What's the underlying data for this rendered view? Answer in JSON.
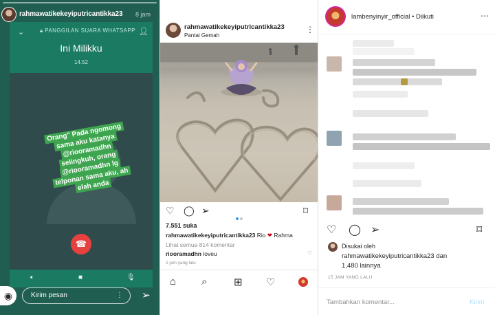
{
  "whatsapp_story": {
    "username": "rahmawatikekeyiputricantikka23",
    "time_ago": "8 jam",
    "call_type": "PANGGILAN SUARA WHATSAPP",
    "contact_name": "Ini Milikku",
    "call_duration": "14.52",
    "sticker_text": "Orang\" Pada ngomong sama aku katanya @riooramadhn selingkuh, orang @riooramadhn lg telponan sama aku, ah elah anda",
    "reply_placeholder": "Kirim pesan",
    "icons": {
      "back": "chevron-down-icon",
      "lock": "lock-icon",
      "add_participant": "add-person-icon",
      "end_call": "phone-hangup-icon",
      "speaker": "speaker-icon",
      "video": "video-icon",
      "mute": "mic-off-icon",
      "camera": "camera-icon",
      "menu": "more-vertical-icon",
      "send": "send-icon"
    }
  },
  "ig_post": {
    "username": "rahmawatikekeyiputricantikka23",
    "location": "Pantai Gemah",
    "likes": "7.551 suka",
    "caption_user": "rahmawatikekeyiputricantikka23",
    "caption_text_1": "Rio",
    "caption_text_2": "Rahma",
    "view_all_comments": "Lihat semua 814 komentar",
    "comment_user": "riooramadhn",
    "comment_text": "loveu",
    "time_ago": "2 jam yang lalu",
    "colors": {
      "carousel_active": "#3897f0",
      "carousel_inactive": "#c7c7c7",
      "heart": "#d0021b"
    }
  },
  "ig_comments": {
    "username": "lambenyinyir_official",
    "follow_status": "• Diikuti",
    "liked_by_prefix": "Disukai oleh",
    "liked_by_user": "rahmawatikekeyiputricantikka23",
    "liked_by_and": "dan",
    "liked_by_others": "1,480 lainnya",
    "time": "15 JAM YANG LALU",
    "comment_placeholder": "Tambahkan komentar...",
    "post_label": "Kirim"
  }
}
